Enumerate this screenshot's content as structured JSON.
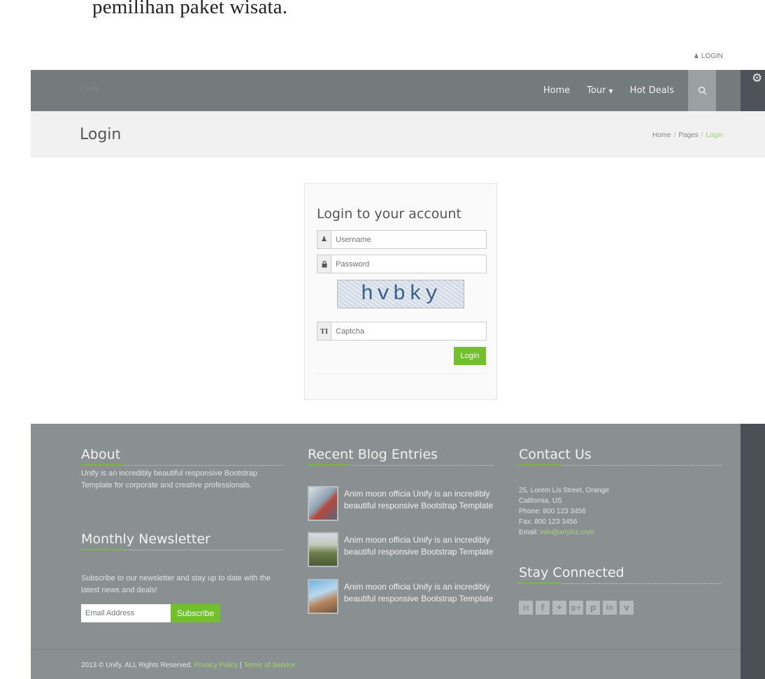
{
  "document": {
    "heading_text": "pemilihan paket wisata."
  },
  "topbar": {
    "login_label": "LOGIN"
  },
  "navbar": {
    "logo_text": "Unify",
    "items": [
      {
        "label": "Home"
      },
      {
        "label": "Tour"
      },
      {
        "label": "Hot Deals"
      }
    ]
  },
  "breadcrumbs": {
    "title": "Login",
    "trail": [
      {
        "label": "Home"
      },
      {
        "label": "Pages"
      },
      {
        "label": "Login"
      }
    ]
  },
  "login": {
    "title": "Login to your account",
    "username_placeholder": "Username",
    "password_placeholder": "Password",
    "captcha_text": "hvbky",
    "captcha_placeholder": "Captcha",
    "submit_label": "Login"
  },
  "footer": {
    "about": {
      "heading": "About",
      "text": "Unify is an incredibly beautiful responsive Bootstrap Template for corporate and creative professionals."
    },
    "newsletter": {
      "heading": "Monthly Newsletter",
      "text": "Subscribe to our newsletter and stay up to date with the latest news and deals!",
      "email_placeholder": "Email Address",
      "subscribe_label": "Subscribe"
    },
    "blog": {
      "heading": "Recent Blog Entries",
      "entries": [
        {
          "text": "Anim moon officia Unify is an incredibly beautiful responsive Bootstrap Template"
        },
        {
          "text": "Anim moon officia Unify is an incredibly beautiful responsive Bootstrap Template"
        },
        {
          "text": "Anim moon officia Unify is an incredibly beautiful responsive Bootstrap Template"
        }
      ]
    },
    "contact": {
      "heading": "Contact Us",
      "address1": "25, Lorem Lis Street, Orange",
      "address2": "California, US",
      "phone": "Phone: 800 123 3456",
      "fax": "Fax: 800 123 3456",
      "email_label": "Email:",
      "email": "info@anybiz.com"
    },
    "social": {
      "heading": "Stay Connected",
      "icons": [
        "rss-icon",
        "facebook-icon",
        "twitter-icon",
        "google-plus-icon",
        "pinterest-icon",
        "linkedin-icon",
        "vimeo-icon"
      ]
    },
    "copyright": {
      "text": "2013 © Unify. ALL Rights Reserved.",
      "privacy": "Privacy Policy",
      "separator": "|",
      "terms": "Terms of Service"
    }
  },
  "colors": {
    "accent": "#72c02c",
    "navbar": "#747b7c",
    "footer": "#8a9091"
  }
}
